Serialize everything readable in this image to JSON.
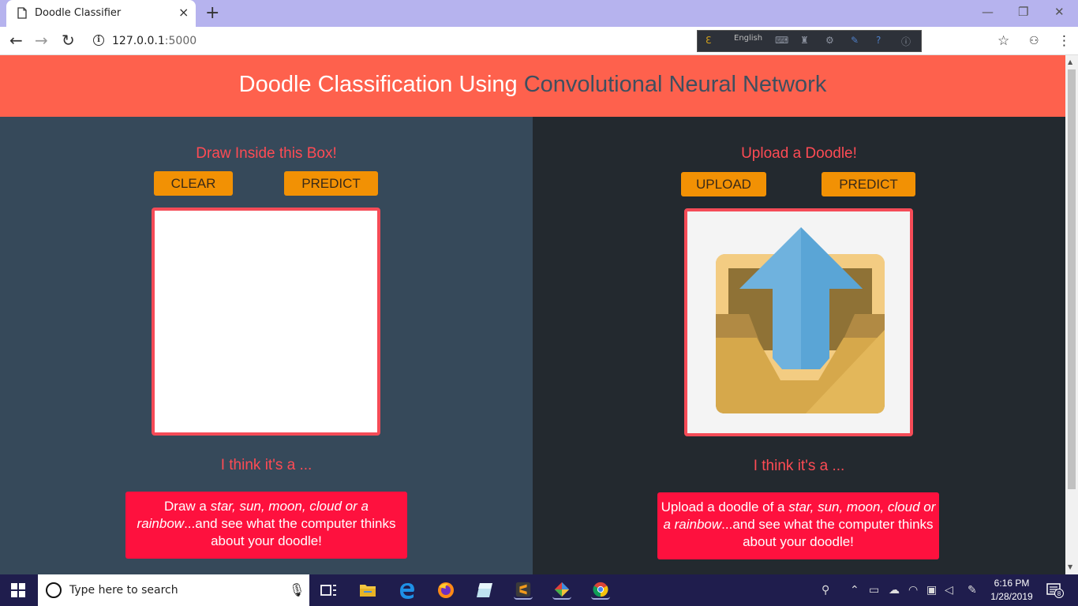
{
  "browser": {
    "tab_title": "Doodle Classifier",
    "tab_close": "×",
    "new_tab": "+",
    "url_host": "127.0.0.1",
    "url_port": ":5000",
    "lang_label": "English",
    "back": "←",
    "forward": "→",
    "reload": "↻",
    "minimize": "—",
    "restore": "❐",
    "close": "✕",
    "star": "☆",
    "menu": "⋮"
  },
  "page": {
    "title_part1": "Doodle Classification Using",
    "title_part2": "Convolutional Neural Network",
    "left": {
      "heading": "Draw Inside this Box!",
      "clear_label": "CLEAR",
      "predict_label": "PREDICT",
      "think_label": "I think it's a ...",
      "message_prefix": "Draw a ",
      "message_items": "star, sun, moon, cloud or a rainbow",
      "message_suffix": "...and see what the computer thinks about your doodle!"
    },
    "right": {
      "heading": "Upload a Doodle!",
      "upload_label": "UPLOAD",
      "predict_label": "PREDICT",
      "think_label": "I think it's a ...",
      "message_prefix": "Upload a doodle of a ",
      "message_items": "star, sun, moon, cloud or a rainbow",
      "message_suffix": "...and see what the computer thinks about your doodle!"
    }
  },
  "taskbar": {
    "search_placeholder": "Type here to search",
    "time": "6:16 PM",
    "date": "1/28/2019",
    "notification_count": "8"
  },
  "colors": {
    "header_bg": "#fe614d",
    "left_panel_bg": "#36495a",
    "right_panel_bg": "#23292f",
    "accent_red": "#fe4b54",
    "button_orange": "#f29104",
    "message_bg": "#fe113e"
  }
}
